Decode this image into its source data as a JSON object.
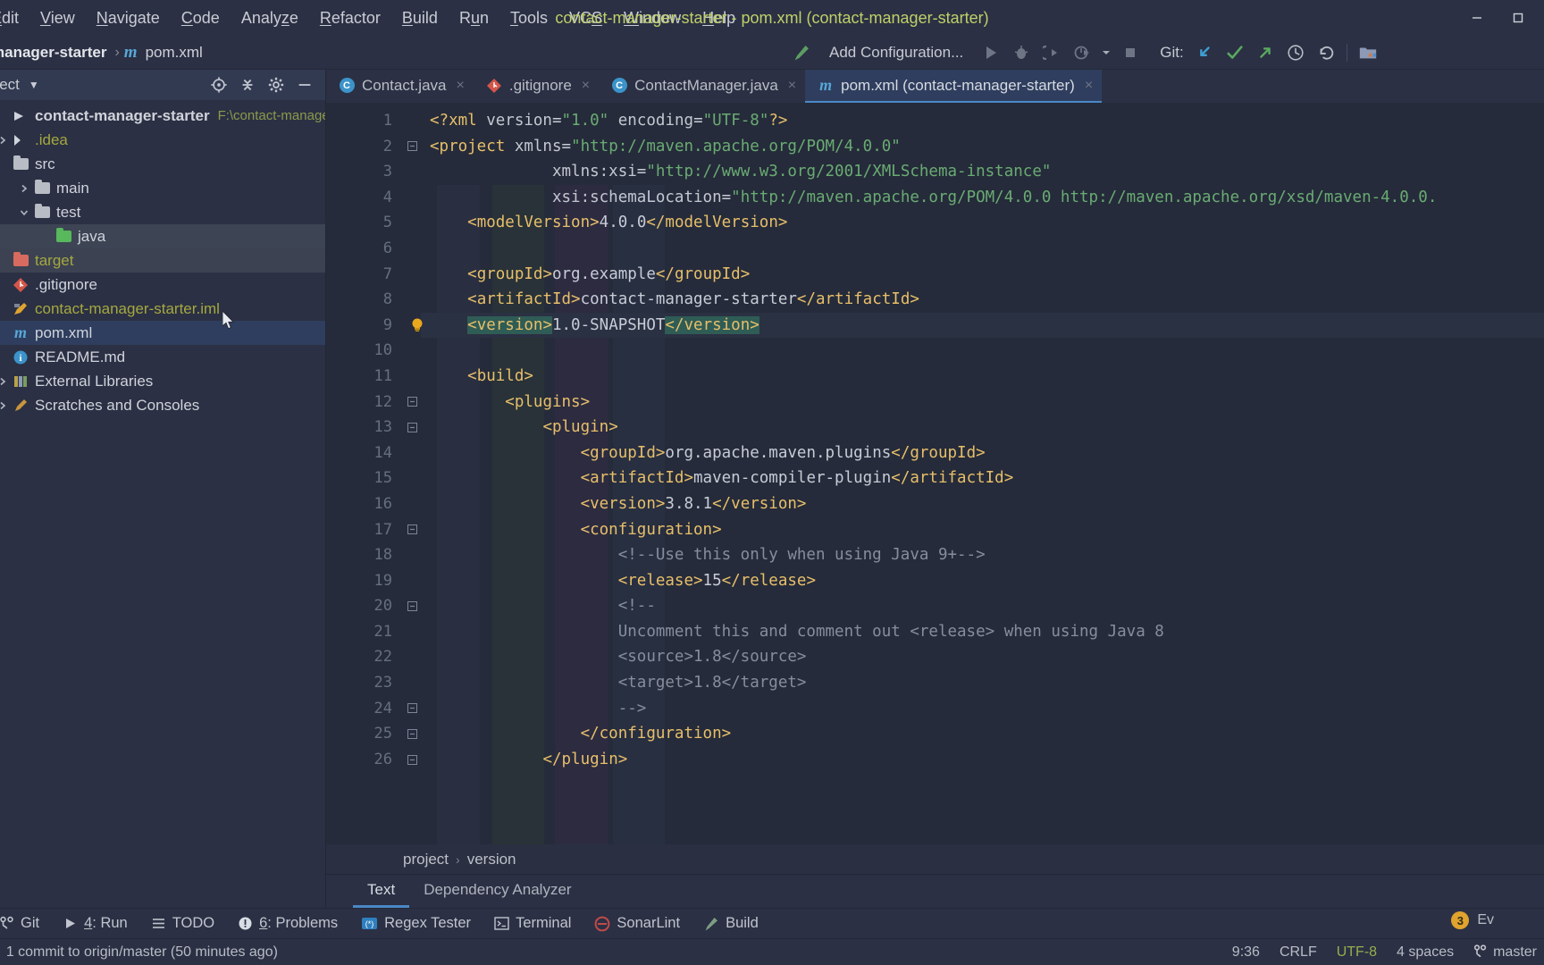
{
  "window": {
    "title": "contact-manager-starter - pom.xml (contact-manager-starter)",
    "minimize_label": "—",
    "maximize_label": "❐"
  },
  "menubar": {
    "items": [
      {
        "label": "Edit",
        "mnemonic": "E"
      },
      {
        "label": "View",
        "mnemonic": "V"
      },
      {
        "label": "Navigate",
        "mnemonic": "N"
      },
      {
        "label": "Code",
        "mnemonic": "C"
      },
      {
        "label": "Analyze",
        "mnemonic": "z"
      },
      {
        "label": "Refactor",
        "mnemonic": "R"
      },
      {
        "label": "Build",
        "mnemonic": "B"
      },
      {
        "label": "Run",
        "mnemonic": "u"
      },
      {
        "label": "Tools",
        "mnemonic": "T"
      },
      {
        "label": "VCS",
        "mnemonic": "S"
      },
      {
        "label": "Window",
        "mnemonic": "W"
      },
      {
        "label": "Help",
        "mnemonic": "H"
      }
    ]
  },
  "navbar": {
    "breadcrumb": [
      "manager-starter",
      "pom.xml"
    ],
    "file_icon": "maven-m-icon",
    "build_icon": "build-hammer-icon",
    "add_configuration": "Add Configuration...",
    "run_icon": "run-icon",
    "debug_icon": "debug-icon",
    "run_coverage_icon": "run-with-coverage-icon",
    "profile_icon": "profiler-icon",
    "dropdown_icon": "chevron-down-icon",
    "stop_icon": "stop-icon",
    "git_label": "Git:",
    "git_update_icon": "update-project-icon",
    "git_commit_icon": "commit-checkmark-icon",
    "git_push_icon": "push-arrow-icon",
    "git_history_icon": "history-clock-icon",
    "git_rollback_icon": "rollback-undo-icon",
    "search_icon": "search-everywhere-icon"
  },
  "project_pane": {
    "title": "oject",
    "caret_icon": "chevron-down-icon",
    "actions": [
      {
        "name": "select-opened-file-icon"
      },
      {
        "name": "collapse-all-icon"
      },
      {
        "name": "settings-gear-icon"
      },
      {
        "name": "hide-icon"
      }
    ],
    "tree": [
      {
        "label": "contact-manager-starter",
        "path": "F:\\contact-manager-sta",
        "icon": "project-root-icon",
        "indent": 0,
        "twisty": "",
        "state": "none",
        "color": "white",
        "bold": true
      },
      {
        "label": ".idea",
        "icon": "idea-folder-icon",
        "indent": 0,
        "twisty": "›",
        "state": "none",
        "color": "olive"
      },
      {
        "label": "src",
        "icon": "folder-icon",
        "indent": 0,
        "twisty": "",
        "state": "none",
        "color": "white"
      },
      {
        "label": "main",
        "icon": "folder-icon",
        "indent": 1,
        "twisty": "›",
        "state": "none",
        "color": "white"
      },
      {
        "label": "test",
        "icon": "folder-icon",
        "indent": 1,
        "twisty": "⌄",
        "state": "none",
        "color": "white"
      },
      {
        "label": "java",
        "icon": "source-folder-green-icon",
        "indent": 2,
        "twisty": "",
        "state": "sel-green",
        "color": "white"
      },
      {
        "label": "target",
        "icon": "excluded-folder-red-icon",
        "indent": 0,
        "twisty": "",
        "state": "sel-grey",
        "color": "olive"
      },
      {
        "label": ".gitignore",
        "icon": "gitignore-icon",
        "indent": 0,
        "twisty": "",
        "state": "none",
        "color": "white"
      },
      {
        "label": "contact-manager-starter.iml",
        "icon": "iml-module-icon",
        "indent": 0,
        "twisty": "",
        "state": "none",
        "color": "olive"
      },
      {
        "label": "pom.xml",
        "icon": "maven-m-icon",
        "indent": 0,
        "twisty": "",
        "state": "sel-blue",
        "color": "white"
      },
      {
        "label": "README.md",
        "icon": "readme-info-icon",
        "indent": 0,
        "twisty": "",
        "state": "none",
        "color": "white"
      },
      {
        "label": "External Libraries",
        "icon": "library-icon",
        "indent": 0,
        "twisty": "›",
        "state": "none",
        "color": "white"
      },
      {
        "label": "Scratches and Consoles",
        "icon": "scratches-icon",
        "indent": 0,
        "twisty": "›",
        "state": "none",
        "color": "white"
      }
    ]
  },
  "editor_tabs": [
    {
      "label": "Contact.java",
      "icon": "java-class-icon",
      "active": false,
      "close": "×"
    },
    {
      "label": ".gitignore",
      "icon": "gitignore-icon",
      "active": false,
      "close": "×"
    },
    {
      "label": "ContactManager.java",
      "icon": "java-class-icon",
      "active": false,
      "close": "×"
    },
    {
      "label": "pom.xml (contact-manager-starter)",
      "icon": "maven-m-icon",
      "active": true,
      "close": "×"
    }
  ],
  "editor": {
    "first_line": 1,
    "lightbulb_line": 9,
    "lightbulb_icon": "intention-bulb-icon",
    "lines": [
      {
        "n": 1,
        "tokens": [
          {
            "t": "<?xml ",
            "c": "tag"
          },
          {
            "t": "version",
            "c": "attr"
          },
          {
            "t": "=",
            "c": "txt"
          },
          {
            "t": "\"1.0\"",
            "c": "val"
          },
          {
            "t": " ",
            "c": "txt"
          },
          {
            "t": "encoding",
            "c": "attr"
          },
          {
            "t": "=",
            "c": "txt"
          },
          {
            "t": "\"UTF-8\"",
            "c": "val"
          },
          {
            "t": "?>",
            "c": "tag"
          }
        ]
      },
      {
        "n": 2,
        "fold": "⊖",
        "tokens": [
          {
            "t": "<project ",
            "c": "tag"
          },
          {
            "t": "xmlns",
            "c": "attr"
          },
          {
            "t": "=",
            "c": "txt"
          },
          {
            "t": "\"http://maven.apache.org/POM/4.0.0\"",
            "c": "val"
          }
        ]
      },
      {
        "n": 3,
        "tokens": [
          {
            "t": "             xmlns:xsi",
            "c": "attr"
          },
          {
            "t": "=",
            "c": "txt"
          },
          {
            "t": "\"http://www.w3.org/2001/XMLSchema-instance\"",
            "c": "val"
          }
        ]
      },
      {
        "n": 4,
        "tokens": [
          {
            "t": "             xsi:schemaLocation",
            "c": "attr"
          },
          {
            "t": "=",
            "c": "txt"
          },
          {
            "t": "\"http://maven.apache.org/POM/4.0.0 http://maven.apache.org/xsd/maven-4.0.0.",
            "c": "val"
          }
        ]
      },
      {
        "n": 5,
        "tokens": [
          {
            "t": "    ",
            "c": "txt"
          },
          {
            "t": "<modelVersion>",
            "c": "tag"
          },
          {
            "t": "4.0.0",
            "c": "txt"
          },
          {
            "t": "</modelVersion>",
            "c": "tag"
          }
        ]
      },
      {
        "n": 6,
        "tokens": []
      },
      {
        "n": 7,
        "tokens": [
          {
            "t": "    ",
            "c": "txt"
          },
          {
            "t": "<groupId>",
            "c": "tag"
          },
          {
            "t": "org.example",
            "c": "txt"
          },
          {
            "t": "</groupId>",
            "c": "tag"
          }
        ]
      },
      {
        "n": 8,
        "tokens": [
          {
            "t": "    ",
            "c": "txt"
          },
          {
            "t": "<artifactId>",
            "c": "tag"
          },
          {
            "t": "contact-manager-starter",
            "c": "txt"
          },
          {
            "t": "</artifactId>",
            "c": "tag"
          }
        ]
      },
      {
        "n": 9,
        "highlight": true,
        "tokens": [
          {
            "t": "    ",
            "c": "txt"
          },
          {
            "t": "<version>",
            "c": "tag-sel"
          },
          {
            "t": "1.0-SNAPSHOT",
            "c": "txt"
          },
          {
            "t": "</version>",
            "c": "tag-sel"
          }
        ]
      },
      {
        "n": 10,
        "tokens": []
      },
      {
        "n": 11,
        "tokens": [
          {
            "t": "    ",
            "c": "txt"
          },
          {
            "t": "<build>",
            "c": "tag"
          }
        ]
      },
      {
        "n": 12,
        "fold": "⊖",
        "tokens": [
          {
            "t": "        ",
            "c": "txt"
          },
          {
            "t": "<plugins>",
            "c": "tag"
          }
        ]
      },
      {
        "n": 13,
        "fold": "⊖",
        "tokens": [
          {
            "t": "            ",
            "c": "txt"
          },
          {
            "t": "<plugin>",
            "c": "tag"
          }
        ]
      },
      {
        "n": 14,
        "tokens": [
          {
            "t": "                ",
            "c": "txt"
          },
          {
            "t": "<groupId>",
            "c": "tag"
          },
          {
            "t": "org.apache.maven.plugins",
            "c": "txt"
          },
          {
            "t": "</groupId>",
            "c": "tag"
          }
        ]
      },
      {
        "n": 15,
        "tokens": [
          {
            "t": "                ",
            "c": "txt"
          },
          {
            "t": "<artifactId>",
            "c": "tag"
          },
          {
            "t": "maven-compiler-plugin",
            "c": "txt"
          },
          {
            "t": "</artifactId>",
            "c": "tag"
          }
        ]
      },
      {
        "n": 16,
        "tokens": [
          {
            "t": "                ",
            "c": "txt"
          },
          {
            "t": "<version>",
            "c": "tag"
          },
          {
            "t": "3.8.1",
            "c": "txt"
          },
          {
            "t": "</version>",
            "c": "tag"
          }
        ]
      },
      {
        "n": 17,
        "fold": "⊖",
        "tokens": [
          {
            "t": "                ",
            "c": "txt"
          },
          {
            "t": "<configuration>",
            "c": "tag"
          }
        ]
      },
      {
        "n": 18,
        "tokens": [
          {
            "t": "                    <!--Use this only when using Java 9+-->",
            "c": "cmt"
          }
        ]
      },
      {
        "n": 19,
        "tokens": [
          {
            "t": "                    ",
            "c": "txt"
          },
          {
            "t": "<release>",
            "c": "tag"
          },
          {
            "t": "15",
            "c": "txt"
          },
          {
            "t": "</release>",
            "c": "tag"
          }
        ]
      },
      {
        "n": 20,
        "fold": "⊖",
        "tokens": [
          {
            "t": "                    <!--",
            "c": "cmt"
          }
        ]
      },
      {
        "n": 21,
        "tokens": [
          {
            "t": "                    Uncomment this and comment out <release> when using Java 8",
            "c": "cmt"
          }
        ]
      },
      {
        "n": 22,
        "tokens": [
          {
            "t": "                    <source>1.8</source>",
            "c": "cmt"
          }
        ]
      },
      {
        "n": 23,
        "tokens": [
          {
            "t": "                    <target>1.8</target>",
            "c": "cmt"
          }
        ]
      },
      {
        "n": 24,
        "fold": "⊖",
        "tokens": [
          {
            "t": "                    -->",
            "c": "cmt"
          }
        ]
      },
      {
        "n": 25,
        "fold": "⊖",
        "tokens": [
          {
            "t": "                ",
            "c": "txt"
          },
          {
            "t": "</configuration>",
            "c": "tag"
          }
        ]
      },
      {
        "n": 26,
        "fold": "⊖",
        "tokens": [
          {
            "t": "            ",
            "c": "txt"
          },
          {
            "t": "</plugin>",
            "c": "tag"
          }
        ]
      }
    ],
    "breadcrumb": [
      "project",
      "version"
    ],
    "bottom_tabs": [
      {
        "label": "Text",
        "active": true
      },
      {
        "label": "Dependency Analyzer",
        "active": false
      }
    ]
  },
  "tool_window_bar": [
    {
      "label": "Git",
      "icon": "git-branch-icon",
      "mnemonic": ""
    },
    {
      "label": "4: Run",
      "icon": "run-play-icon",
      "mnemonic": "4"
    },
    {
      "label": "TODO",
      "icon": "todo-list-icon",
      "mnemonic": ""
    },
    {
      "label": "6: Problems",
      "icon": "problems-warning-icon",
      "mnemonic": "6"
    },
    {
      "label": "Regex Tester",
      "icon": "regex-tester-icon",
      "mnemonic": ""
    },
    {
      "label": "Terminal",
      "icon": "terminal-icon",
      "mnemonic": ""
    },
    {
      "label": "SonarLint",
      "icon": "sonarlint-icon",
      "mnemonic": ""
    },
    {
      "label": "Build",
      "icon": "build-hammer-icon",
      "mnemonic": ""
    }
  ],
  "statusbar": {
    "message": "1 commit to origin/master (50 minutes ago)",
    "message_icon": "vcs-commit-icon",
    "position": "9:36",
    "line_separator": "CRLF",
    "encoding": "UTF-8",
    "indent": "4 spaces",
    "branch": "master",
    "branch_icon": "git-branch-icon",
    "event_badge": "3",
    "event_label": "Ev"
  },
  "colors": {
    "accent_blue": "#4a88c7",
    "title_green": "#bfd068",
    "encoding_green": "#96ae4e",
    "tag_orange": "#e8bf6a",
    "value_green": "#6aab73",
    "comment_gray": "#868d9c",
    "selection_teal": "#2f5c55"
  }
}
